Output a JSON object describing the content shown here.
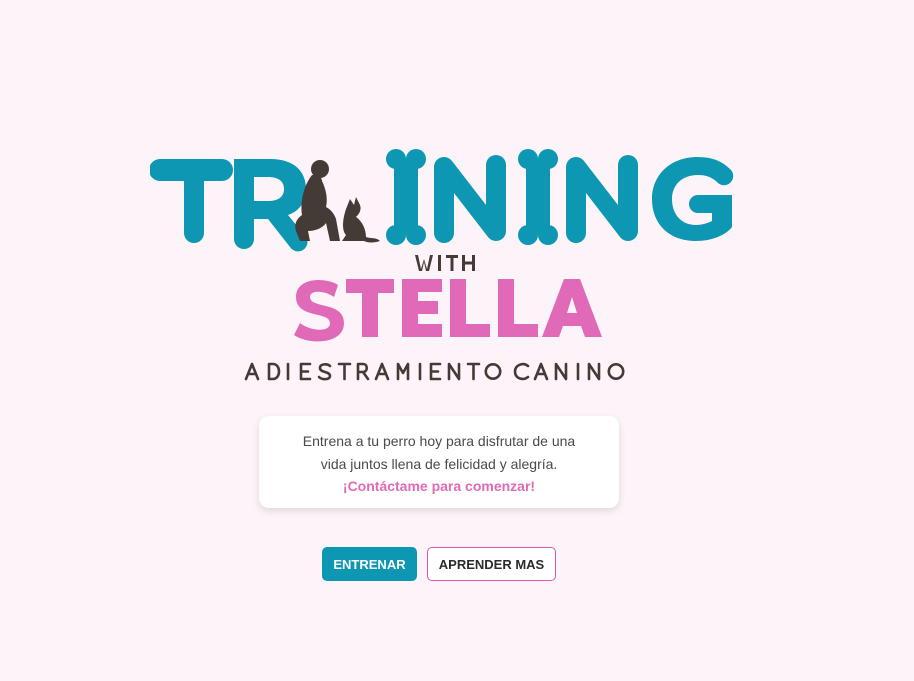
{
  "logo": {
    "word_training": "TRAINING",
    "word_with": "WITH",
    "word_stella": "STELLA",
    "tagline": "ADIESTRAMIENTO CANINO",
    "colors": {
      "teal": "#0e97b3",
      "pink": "#e06ab8",
      "dark": "#443a36"
    },
    "icons": [
      "woman-and-dog-silhouette-icon",
      "bone-icon"
    ]
  },
  "intro": {
    "text": "Entrena a tu perro hoy para disfrutar de una vida juntos llena de felicidad y alegría.",
    "cta": "¡Contáctame para comenzar!"
  },
  "buttons": {
    "primary_label": "ENTRENAR",
    "secondary_label": "APRENDER MAS"
  },
  "colors": {
    "background": "#fdf4f9",
    "accent_teal": "#0e97b3",
    "accent_pink": "#e06ab8"
  }
}
